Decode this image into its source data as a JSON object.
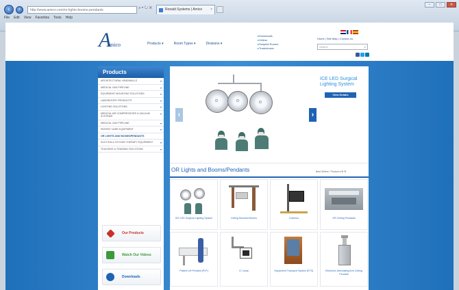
{
  "browser": {
    "address": "http://www.amico.com/or-lights-booms-pendants",
    "address_tools": "⌕ • ↻ ✕",
    "tab_title": "Ronald Systems | Amico",
    "tab_close": "×",
    "menu": [
      "File",
      "Edit",
      "View",
      "Favorites",
      "Tools",
      "Help"
    ],
    "window_controls": [
      "–",
      "□",
      "✕"
    ]
  },
  "header": {
    "logo_a": "A",
    "logo_text": "mico",
    "nav": [
      "Products ▾",
      "Room Types ▾",
      "Divisions ▾"
    ],
    "quick_links": [
      "Downloads",
      "Videos",
      "Hospital Rooms",
      "Tradeshows"
    ],
    "top_links": "Home | Site Map | Contact us",
    "search_placeholder": "Search",
    "search_icon": "⌕",
    "colors": {
      "brand_blue": "#1f63b3",
      "page_bg": "#2a7fc6"
    }
  },
  "sidebar": {
    "title": "Products",
    "items": [
      "Architectural Headwalls",
      "Medical Gas Pipeline",
      "Equipment Mounting Solutions",
      "Laboratory Products",
      "Lighting Solutions",
      "Medical Air Compressors & Vacuum Systems",
      "Medical Gas Pipeline",
      "Patient Care Equipment",
      "OR Lights and Booms/Pendants",
      "Suction & Oxygen Therapy Equipment",
      "Teaching & Training Solutions"
    ],
    "active_index": 8,
    "promos": [
      {
        "label": "Our Products",
        "icon": "tag-icon",
        "color": "#c9302c"
      },
      {
        "label": "Watch Our Videos",
        "icon": "video-icon",
        "color": "#3c9a3c"
      },
      {
        "label": "Downloads",
        "icon": "download-icon",
        "color": "#1f63b3"
      }
    ]
  },
  "banner": {
    "title": "ICE LED Surgical Lighting System",
    "button": "View Details",
    "prev": "‹",
    "next": "›"
  },
  "section": {
    "title": "OR Lights and Booms/Pendants",
    "tools": "Best Sellers / Product ▾  ⊞  ☰"
  },
  "products": [
    {
      "caption": "ICE LED Surgical Lighting System",
      "kind": "lights"
    },
    {
      "caption": "Ceiling Mounted Booms",
      "kind": "boom"
    },
    {
      "caption": "Columns",
      "kind": "column"
    },
    {
      "caption": "OR Ceiling Pendants",
      "kind": "room"
    },
    {
      "caption": "Patient Lift Pendant (PLP)",
      "kind": "patient"
    },
    {
      "caption": "IC Lamp",
      "kind": "arm"
    },
    {
      "caption": "Equipment Transport System (ETS)",
      "kind": "transport"
    },
    {
      "caption": "Electronic Articulating Arm Ceiling Pendant",
      "kind": "pendant"
    }
  ]
}
